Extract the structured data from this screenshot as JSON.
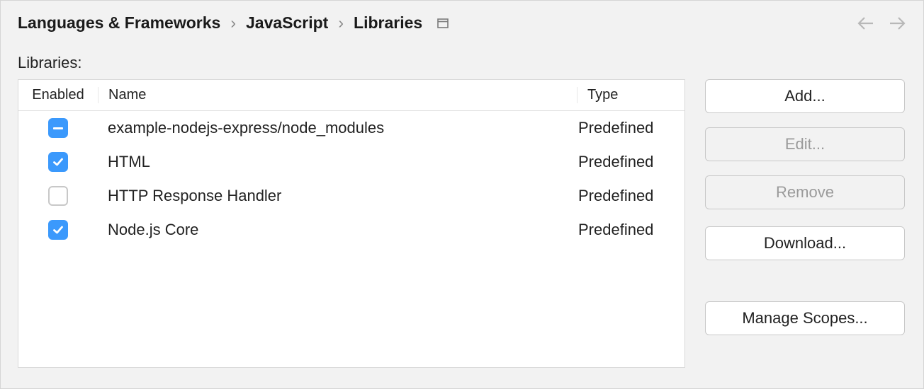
{
  "breadcrumb": {
    "part1": "Languages & Frameworks",
    "part2": "JavaScript",
    "part3": "Libraries"
  },
  "section": {
    "label": "Libraries:"
  },
  "table": {
    "headers": {
      "enabled": "Enabled",
      "name": "Name",
      "type": "Type"
    },
    "rows": [
      {
        "state": "indeterminate",
        "name": "example-nodejs-express/node_modules",
        "type": "Predefined"
      },
      {
        "state": "checked",
        "name": "HTML",
        "type": "Predefined"
      },
      {
        "state": "unchecked",
        "name": "HTTP Response Handler",
        "type": "Predefined"
      },
      {
        "state": "checked",
        "name": "Node.js Core",
        "type": "Predefined"
      }
    ]
  },
  "buttons": {
    "add": "Add...",
    "edit": "Edit...",
    "remove": "Remove",
    "download": "Download...",
    "manage": "Manage Scopes..."
  }
}
